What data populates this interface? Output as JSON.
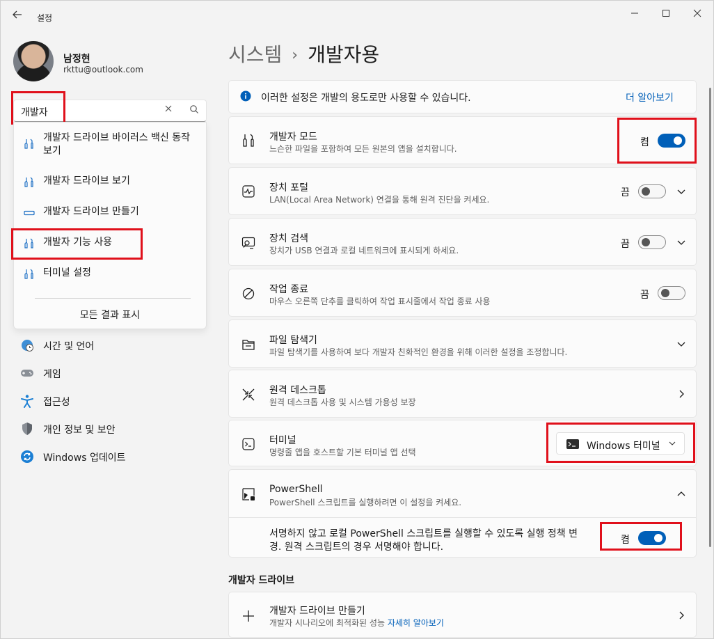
{
  "window": {
    "title": "설정",
    "min_icon": "minimize-icon",
    "max_icon": "maximize-icon",
    "close_icon": "close-icon"
  },
  "profile": {
    "name": "남정현",
    "email": "rkttu@outlook.com"
  },
  "search": {
    "value": "개발자",
    "results": [
      {
        "label": "개발자 드라이브 바이러스 백신 동작 보기",
        "icon": "developer-tools-icon"
      },
      {
        "label": "개발자 드라이브 보기",
        "icon": "developer-tools-icon"
      },
      {
        "label": "개발자 드라이브 만들기",
        "icon": "drive-icon"
      },
      {
        "label": "개발자 기능 사용",
        "icon": "developer-tools-icon"
      },
      {
        "label": "터미널 설정",
        "icon": "developer-tools-icon"
      }
    ],
    "show_all": "모든 결과 표시"
  },
  "nav": [
    {
      "label": "시간 및 언어",
      "icon": "globe-clock-icon"
    },
    {
      "label": "게임",
      "icon": "gamepad-icon"
    },
    {
      "label": "접근성",
      "icon": "accessibility-icon"
    },
    {
      "label": "개인 정보 및 보안",
      "icon": "shield-icon"
    },
    {
      "label": "Windows 업데이트",
      "icon": "update-icon"
    }
  ],
  "breadcrumb": {
    "parent": "시스템",
    "separator": "›",
    "current": "개발자용"
  },
  "info": {
    "text": "이러한 설정은 개발의 용도로만 사용할 수 있습니다.",
    "link": "더 알아보기"
  },
  "settings": {
    "dev_mode": {
      "title": "개발자 모드",
      "desc": "느슨한 파일을 포함하여 모든 원본의 앱을 설치합니다.",
      "state": "켬"
    },
    "device_portal": {
      "title": "장치 포털",
      "desc": "LAN(Local Area Network) 연결을 통해 원격 진단을 켜세요.",
      "state": "끔"
    },
    "device_discovery": {
      "title": "장치 검색",
      "desc": "장치가 USB 연결과 로컬 네트워크에 표시되게 하세요.",
      "state": "끔"
    },
    "end_task": {
      "title": "작업 종료",
      "desc": "마우스 오른쪽 단추를 클릭하여 작업 표시줄에서 작업 종료 사용",
      "state": "끔"
    },
    "file_explorer": {
      "title": "파일 탐색기",
      "desc": "파일 탐색기를 사용하여 보다 개발자 친화적인 환경을 위해 이러한 설정을 조정합니다."
    },
    "remote_desktop": {
      "title": "원격 데스크톱",
      "desc": "원격 데스크톱 사용 및 시스템 가용성 보장"
    },
    "terminal": {
      "title": "터미널",
      "desc": "명령줄 앱을 호스트할 기본 터미널 앱 선택",
      "selected": "Windows 터미널"
    },
    "powershell": {
      "title": "PowerShell",
      "desc": "PowerShell 스크립트를 실행하려면 이 설정을 켜세요.",
      "sub_line1": "서명하지 않고 로컬 PowerShell 스크립트를 실행할 수 있도록 실행 정책 변",
      "sub_line2": "경. 원격 스크립트의 경우 서명해야 합니다.",
      "state": "켬"
    }
  },
  "dev_drive": {
    "section": "개발자 드라이브",
    "title": "개발자 드라이브 만들기",
    "desc": "개발자 시나리오에 최적화된 성능",
    "link": "자세히 알아보기"
  },
  "colors": {
    "accent": "#005fb8",
    "highlight": "#e0101b"
  }
}
